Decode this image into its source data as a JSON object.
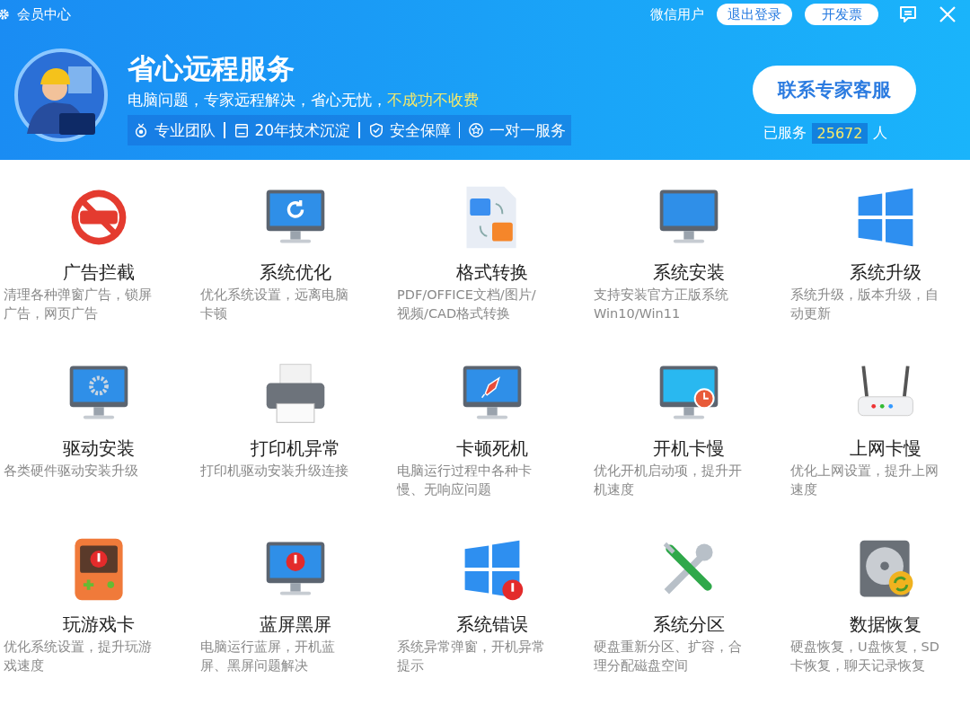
{
  "titlebar": {
    "title": "会员中心",
    "user": "微信用户",
    "buttons": [
      "退出登录",
      "开发票"
    ]
  },
  "banner": {
    "title": "省心远程服务",
    "slogan": "电脑问题，专家远程解决，省心无忧，",
    "slogan_highlight": "不成功不收费",
    "features": [
      {
        "kind": "medal",
        "label": "专业团队"
      },
      {
        "kind": "calendar",
        "label": "20年技术沉淀"
      },
      {
        "kind": "shield",
        "label": "安全保障"
      },
      {
        "kind": "star",
        "label": "一对一服务"
      }
    ],
    "contact_button": "联系专家客服",
    "served_prefix": "已服务",
    "served_count": "25672",
    "served_suffix": "人"
  },
  "services": [
    {
      "kind": "ads",
      "title": "广告拦截",
      "desc": [
        "清理各种弹窗广告，锁屏",
        "广告，网页广告"
      ]
    },
    {
      "kind": "monitor-refresh",
      "title": "系统优化",
      "desc": [
        "优化系统设置，远离电脑",
        "卡顿"
      ]
    },
    {
      "kind": "doc-pdf",
      "title": "格式转换",
      "desc": [
        "PDF/OFFICE文档/图片/",
        "视频/CAD格式转换"
      ]
    },
    {
      "kind": "monitor",
      "title": "系统安装",
      "desc": [
        "支持安装官方正版系统",
        "Win10/Win11"
      ]
    },
    {
      "kind": "windows",
      "title": "系统升级",
      "desc": [
        "系统升级，版本升级，自",
        "动更新"
      ]
    },
    {
      "kind": "monitor-gear",
      "title": "驱动安装",
      "desc": [
        "各类硬件驱动安装升级"
      ]
    },
    {
      "kind": "printer",
      "title": "打印机异常",
      "desc": [
        "打印机驱动安装升级连接"
      ]
    },
    {
      "kind": "monitor-rocket",
      "title": "卡顿死机",
      "desc": [
        "电脑运行过程中各种卡",
        "慢、无响应问题"
      ]
    },
    {
      "kind": "monitor-clock",
      "title": "开机卡慢",
      "desc": [
        "优化开机启动项，提升开",
        "机速度"
      ]
    },
    {
      "kind": "router",
      "title": "上网卡慢",
      "desc": [
        "优化上网设置，提升上网",
        "速度"
      ]
    },
    {
      "kind": "gamepad",
      "title": "玩游戏卡",
      "desc": [
        "优化系统设置，提升玩游",
        "戏速度"
      ]
    },
    {
      "kind": "monitor-alert",
      "title": "蓝屏黑屏",
      "desc": [
        "电脑运行蓝屏，开机蓝",
        "屏、黑屏问题解决"
      ]
    },
    {
      "kind": "windows-alert",
      "title": "系统错误",
      "desc": [
        "系统异常弹窗，开机异常",
        "提示"
      ]
    },
    {
      "kind": "tools",
      "title": "系统分区",
      "desc": [
        "硬盘重新分区、扩容，合",
        "理分配磁盘空间"
      ]
    },
    {
      "kind": "disk",
      "title": "数据恢复",
      "desc": [
        "硬盘恢复，U盘恢复，SD",
        "卡恢复，聊天记录恢复"
      ]
    }
  ]
}
